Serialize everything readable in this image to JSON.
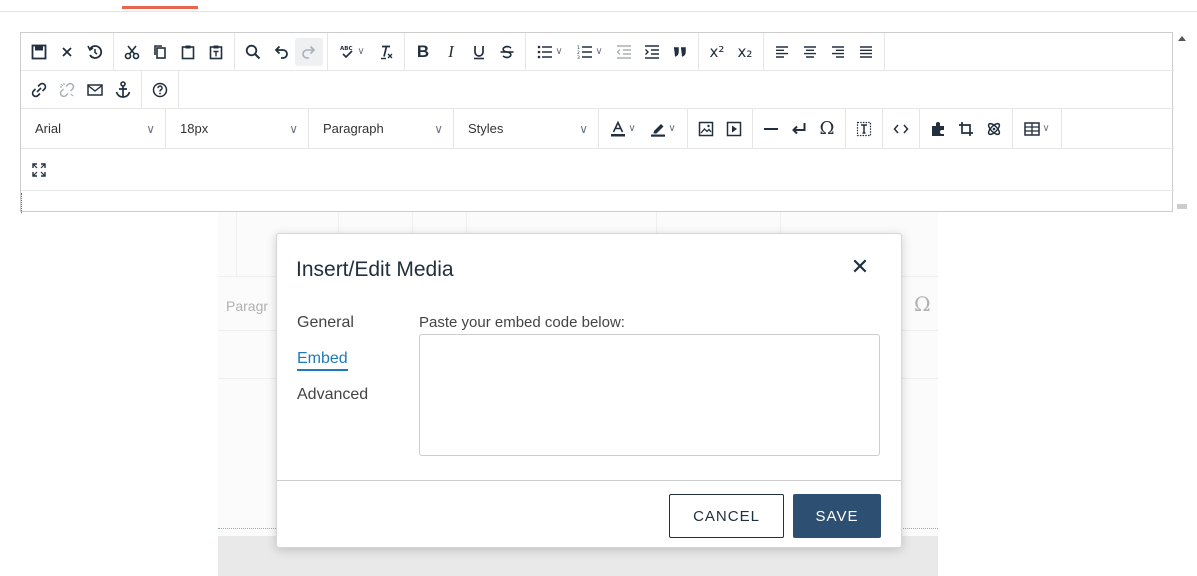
{
  "toolbar": {
    "row1": {
      "icons": [
        "save-icon",
        "cancel-icon",
        "restore-draft-icon",
        "cut-icon",
        "copy-icon",
        "paste-icon",
        "paste-as-text-icon",
        "find-replace-icon",
        "undo-icon",
        "redo-icon",
        "spellcheck-icon",
        "clear-formatting-icon",
        "bold-icon",
        "italic-icon",
        "underline-icon",
        "strikethrough-icon",
        "bullet-list-icon",
        "numbered-list-icon",
        "outdent-icon",
        "indent-icon",
        "blockquote-icon",
        "superscript-icon",
        "subscript-icon",
        "align-left-icon",
        "align-center-icon",
        "align-right-icon",
        "justify-icon"
      ],
      "bold_label": "B",
      "italic_label": "I",
      "superscript_label": "x²",
      "subscript_label": "x₂"
    },
    "row2": {
      "icons": [
        "link-icon",
        "unlink-icon",
        "email-icon",
        "anchor-icon",
        "help-icon"
      ]
    },
    "row3": {
      "font_family": "Arial",
      "font_size": "18px",
      "block_format": "Paragraph",
      "styles": "Styles",
      "icons": [
        "text-color-icon",
        "highlight-color-icon",
        "image-icon",
        "media-icon",
        "horizontal-line-icon",
        "line-break-icon",
        "special-character-icon",
        "template-icon",
        "source-code-icon",
        "plugin-icon",
        "crop-icon",
        "atom-icon",
        "table-icon"
      ],
      "omega_label": "Ω"
    },
    "row4": {
      "icons": [
        "fullscreen-icon"
      ]
    }
  },
  "background": {
    "paragraph_text": "Paragr",
    "omega_text": "Ω"
  },
  "modal": {
    "title": "Insert/Edit Media",
    "close_label": "✕",
    "tabs": [
      "General",
      "Embed",
      "Advanced"
    ],
    "active_tab": "Embed",
    "embed_label": "Paste your embed code below:",
    "embed_value": "",
    "cancel_label": "CANCEL",
    "save_label": "SAVE"
  },
  "colors": {
    "accent_tab": "#e8674a",
    "save_button": "#2c4f72",
    "active_tab_link": "#207ab7",
    "text": "#222f3e"
  }
}
